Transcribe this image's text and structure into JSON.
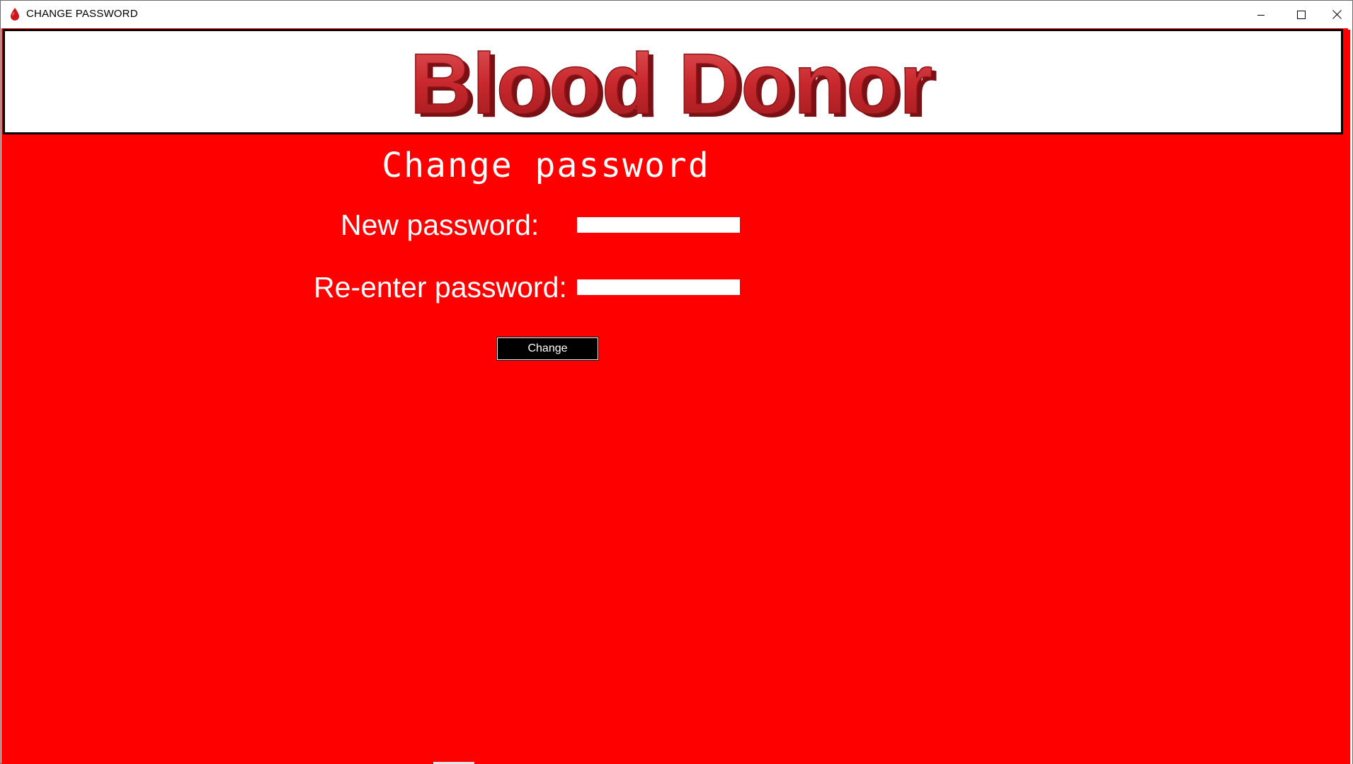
{
  "window": {
    "title": "CHANGE PASSWORD",
    "app_icon": "blood-drop-icon",
    "controls": {
      "minimize_icon": "minimize-icon",
      "maximize_icon": "maximize-icon",
      "close_icon": "close-icon"
    }
  },
  "banner": {
    "logo_text": "Blood Donor"
  },
  "form": {
    "heading": "Change password",
    "new_password_label": "New password:",
    "new_password_value": "",
    "reenter_password_label": "Re-enter password:",
    "reenter_password_value": "",
    "submit_label": "Change"
  },
  "colors": {
    "background": "#ff0000",
    "banner_background": "#ffffff",
    "logo_red": "#c8282d",
    "button_background": "#000000",
    "text": "#ffffff"
  }
}
